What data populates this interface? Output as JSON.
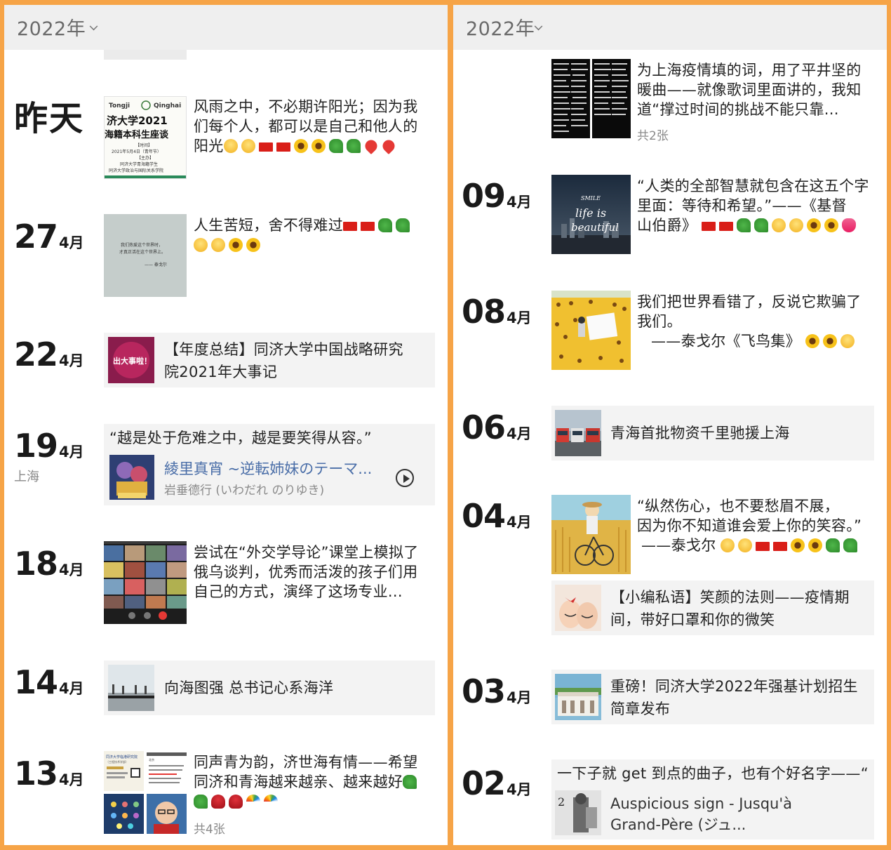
{
  "left": {
    "year": "2022年",
    "posts": [
      {
        "day": "昨天",
        "text": [
          "风雨之中，不必期许阳光；因为我",
          "们每个人，都可以是自己和他人的",
          "阳光"
        ],
        "emojis": [
          "smile",
          "smile",
          "flag",
          "flag",
          "sun",
          "sun",
          "clover",
          "clover",
          "heart",
          "heart"
        ],
        "thumb": {
          "t1": "Tongji",
          "t2": "Qinghai",
          "t3": "济大学2021",
          "t4": "海籍本科生座谈",
          "t5": "【时间】",
          "t6": "2021年5月4日（青年节）",
          "t7": "【主办】",
          "t8": "同济大学青海籍学生",
          "t9": "同济大学政治与国际关系学院"
        }
      },
      {
        "day": "27",
        "month": "4月",
        "text": [
          "人生苦短，舍不得难过"
        ],
        "emojis1": [
          "flag",
          "flag",
          "clover",
          "clover"
        ],
        "emojis2": [
          "smile",
          "smile",
          "sun",
          "sun"
        ],
        "thumb": {
          "l1": "我们热爱这个世界时，",
          "l2": "才真正活在这个世界上。",
          "l3": "—— 泰戈尔"
        }
      },
      {
        "day": "22",
        "month": "4月",
        "card": [
          "【年度总结】同济大学中国战略研究",
          "院2021年大事记"
        ],
        "thumb": {
          "label": "出大事啦！"
        }
      },
      {
        "day": "19",
        "month": "4月",
        "loc": "上海",
        "quote": "“越是处于危难之中，越是要笑得从容。”",
        "music_title": "綾里真宵 ~逆転姉妹のテーマ...",
        "music_artist": "岩垂德行 (いわだれ のりゆき)"
      },
      {
        "day": "18",
        "month": "4月",
        "text": [
          "尝试在“外交学导论”课堂上模拟了",
          "俄乌谈判，优秀而活泼的孩子们用",
          "自己的方式，演绎了这场专业..."
        ]
      },
      {
        "day": "14",
        "month": "4月",
        "card": [
          "向海图强 总书记心系海洋"
        ]
      },
      {
        "day": "13",
        "month": "4月",
        "text": [
          "同声青为韵，济世海有情——希望",
          "同济和青海越来越亲、越来越好"
        ],
        "emojis_end": [
          "clover"
        ],
        "emojis2": [
          "clover",
          "rose",
          "rose",
          "rainbow",
          "rainbow"
        ],
        "count": "共4张",
        "thumb": {
          "t1": "同济大学临港研究院",
          "t2": "（工程技术学部）",
          "t3": "北京"
        }
      }
    ]
  },
  "right": {
    "year": "2022年",
    "posts": [
      {
        "text": [
          "为上海疫情填的词，用了平井坚的",
          "暖曲——就像歌词里面讲的，我知",
          "道“撑过时间的挑战不能只靠..."
        ],
        "count": "共2张"
      },
      {
        "day": "09",
        "month": "4月",
        "text": [
          "“人类的全部智慧就包含在这五个字",
          "里面：等待和希望。”——《基督",
          "山伯爵》"
        ],
        "emojis": [
          "flag",
          "flag",
          "clover",
          "clover",
          "smile",
          "smile",
          "sun",
          "sun",
          "tulip"
        ],
        "thumb": {
          "s1": "SMILE",
          "s2": "life is",
          "s3": "beautiful"
        }
      },
      {
        "day": "08",
        "month": "4月",
        "text": [
          "我们把世界看错了，反说它欺骗了",
          "我们。",
          "——泰戈尔《飞鸟集》"
        ],
        "emojis": [
          "sun",
          "sun",
          "smile"
        ]
      },
      {
        "day": "06",
        "month": "4月",
        "card": [
          "青海首批物资千里驰援上海"
        ]
      },
      {
        "day": "04",
        "month": "4月",
        "text": [
          "“纵然伤心，也不要愁眉不展，",
          "因为你不知道谁会爱上你的笑容。”",
          "——泰戈尔"
        ],
        "emojis": [
          "smile",
          "smile",
          "flag",
          "flag",
          "sun",
          "sun",
          "clover",
          "clover"
        ],
        "card": [
          "【小编私语】笑颜的法则——疫情期",
          "间，带好口罩和你的微笑"
        ]
      },
      {
        "day": "03",
        "month": "4月",
        "card": [
          "重磅！同济大学2022年强基计划招生",
          "简章发布"
        ]
      },
      {
        "day": "02",
        "month": "4月",
        "quote": "一下子就 get 到点的曲子，也有个好名字——“",
        "music_title": [
          "Auspicious sign - Jusqu'à",
          "Grand-Père (ジュ..."
        ],
        "thumb": {
          "num": "2"
        }
      }
    ]
  }
}
